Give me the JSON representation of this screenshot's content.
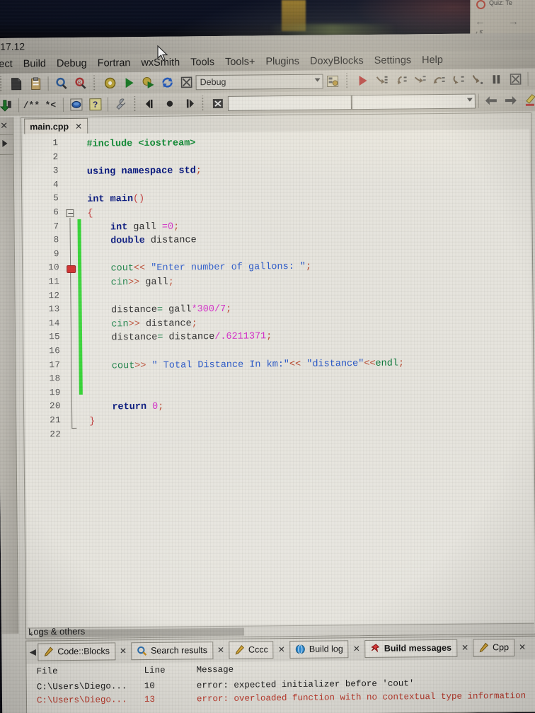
{
  "window": {
    "title": "17.12",
    "corner_window_title": "Quiz: Te"
  },
  "menubar": {
    "items": [
      "ect",
      "Build",
      "Debug",
      "Fortran",
      "wxSmith",
      "Tools",
      "Tools+",
      "Plugins",
      "DoxyBlocks",
      "Settings",
      "Help"
    ]
  },
  "toolbar_main": {
    "icons": [
      "new-file-icon",
      "paste-icon",
      "find-icon",
      "find-replace-icon",
      "build-icon",
      "run-icon",
      "build-and-run-icon",
      "rebuild-icon",
      "abort-icon"
    ],
    "target_combo_value": "Debug",
    "target_combo_placeholder": "Debug",
    "select_target_icon": "select-target-icon"
  },
  "toolbar_debug": {
    "icons": [
      "debug-continue-icon",
      "step-into-icon",
      "step-over-icon",
      "step-out-icon",
      "next-instruction-icon",
      "step-into-instruction-icon",
      "run-to-cursor-icon",
      "break-debugger-icon",
      "stop-debugger-icon",
      "debugging-windows-icon",
      "various-info-icon"
    ]
  },
  "toolbar_secondary": {
    "icons": [
      "jump-back-icon",
      "comment-icon",
      "uncomment-icon",
      "toggle-bookmark-icon",
      "help-icon",
      "settings-wrench-icon",
      "goto-prev-icon",
      "toggle-breakpoint-icon",
      "goto-next-icon",
      "clear-icon"
    ],
    "search_value": "",
    "search_placeholder": "",
    "nav_icons": [
      "search-prev-icon",
      "search-next-icon",
      "highlight-icon",
      "bookmark-icon",
      "match-case-icon",
      "regex-icon"
    ],
    "right_icons": [
      "select-mode-icon",
      "fullscreen-icon"
    ]
  },
  "left_panel": {
    "close_icon": "close-icon",
    "expand_icon": "expand-arrow-icon"
  },
  "editor": {
    "tab_label": "main.cpp",
    "tab_close": "✕",
    "line_numbers": [
      1,
      2,
      3,
      4,
      5,
      6,
      7,
      8,
      9,
      10,
      11,
      12,
      13,
      14,
      15,
      16,
      17,
      18,
      19,
      20,
      21,
      22
    ],
    "breakpoint_line": 10,
    "fold_line": 6,
    "change_bar_from_line": 7,
    "change_bar_to_line": 19,
    "lines": [
      {
        "n": 1,
        "tokens": [
          {
            "t": "#include ",
            "c": "pre"
          },
          {
            "t": "<iostream>",
            "c": "pre"
          }
        ]
      },
      {
        "n": 2,
        "tokens": []
      },
      {
        "n": 3,
        "tokens": [
          {
            "t": "using",
            "c": "kw"
          },
          {
            "t": " ",
            "c": "idf"
          },
          {
            "t": "namespace",
            "c": "kw"
          },
          {
            "t": " ",
            "c": "idf"
          },
          {
            "t": "std",
            "c": "kw"
          },
          {
            "t": ";",
            "c": "op"
          }
        ]
      },
      {
        "n": 4,
        "tokens": []
      },
      {
        "n": 5,
        "tokens": [
          {
            "t": "int",
            "c": "kw"
          },
          {
            "t": " ",
            "c": "idf"
          },
          {
            "t": "main",
            "c": "kw"
          },
          {
            "t": "()",
            "c": "brc"
          }
        ]
      },
      {
        "n": 6,
        "tokens": [
          {
            "t": "{",
            "c": "brc"
          }
        ]
      },
      {
        "n": 7,
        "tokens": [
          {
            "t": "    ",
            "c": "idf"
          },
          {
            "t": "int",
            "c": "kw"
          },
          {
            "t": " gall ",
            "c": "idf"
          },
          {
            "t": "=",
            "c": "num"
          },
          {
            "t": "0",
            "c": "num"
          },
          {
            "t": ";",
            "c": "op"
          }
        ]
      },
      {
        "n": 8,
        "tokens": [
          {
            "t": "    ",
            "c": "idf"
          },
          {
            "t": "double",
            "c": "kw"
          },
          {
            "t": " distance",
            "c": "idf"
          }
        ]
      },
      {
        "n": 9,
        "tokens": []
      },
      {
        "n": 10,
        "tokens": [
          {
            "t": "    ",
            "c": "idf"
          },
          {
            "t": "cout",
            "c": "opg"
          },
          {
            "t": "<<",
            "c": "op"
          },
          {
            "t": " ",
            "c": "idf"
          },
          {
            "t": "\"Enter number of gallons: \"",
            "c": "str"
          },
          {
            "t": ";",
            "c": "op"
          }
        ]
      },
      {
        "n": 11,
        "tokens": [
          {
            "t": "    ",
            "c": "idf"
          },
          {
            "t": "cin",
            "c": "opg"
          },
          {
            "t": ">>",
            "c": "op"
          },
          {
            "t": " gall",
            "c": "idf"
          },
          {
            "t": ";",
            "c": "op"
          }
        ]
      },
      {
        "n": 12,
        "tokens": []
      },
      {
        "n": 13,
        "tokens": [
          {
            "t": "    distance",
            "c": "idf"
          },
          {
            "t": "=",
            "c": "opg"
          },
          {
            "t": " gall",
            "c": "idf"
          },
          {
            "t": "*300",
            "c": "num"
          },
          {
            "t": "/7",
            "c": "num"
          },
          {
            "t": ";",
            "c": "op"
          }
        ]
      },
      {
        "n": 14,
        "tokens": [
          {
            "t": "    ",
            "c": "idf"
          },
          {
            "t": "cin",
            "c": "opg"
          },
          {
            "t": ">>",
            "c": "op"
          },
          {
            "t": " distance",
            "c": "idf"
          },
          {
            "t": ";",
            "c": "op"
          }
        ]
      },
      {
        "n": 15,
        "tokens": [
          {
            "t": "    distance",
            "c": "idf"
          },
          {
            "t": "=",
            "c": "opg"
          },
          {
            "t": " distance",
            "c": "idf"
          },
          {
            "t": "/",
            "c": "num"
          },
          {
            "t": ".6211371",
            "c": "num"
          },
          {
            "t": ";",
            "c": "op"
          }
        ]
      },
      {
        "n": 16,
        "tokens": []
      },
      {
        "n": 17,
        "tokens": [
          {
            "t": "    ",
            "c": "idf"
          },
          {
            "t": "cout",
            "c": "opg"
          },
          {
            "t": ">>",
            "c": "op"
          },
          {
            "t": " ",
            "c": "idf"
          },
          {
            "t": "\" Total Distance In km:\"",
            "c": "str"
          },
          {
            "t": "<<",
            "c": "op"
          },
          {
            "t": " ",
            "c": "idf"
          },
          {
            "t": "\"distance\"",
            "c": "str"
          },
          {
            "t": "<<",
            "c": "op"
          },
          {
            "t": "endl",
            "c": "opg"
          },
          {
            "t": ";",
            "c": "op"
          }
        ]
      },
      {
        "n": 18,
        "tokens": []
      },
      {
        "n": 19,
        "tokens": []
      },
      {
        "n": 20,
        "tokens": [
          {
            "t": "    ",
            "c": "idf"
          },
          {
            "t": "return",
            "c": "kw"
          },
          {
            "t": " ",
            "c": "idf"
          },
          {
            "t": "0",
            "c": "num"
          },
          {
            "t": ";",
            "c": "op"
          }
        ]
      },
      {
        "n": 21,
        "tokens": [
          {
            "t": "}",
            "c": "brc"
          }
        ]
      },
      {
        "n": 22,
        "tokens": []
      }
    ],
    "scroll_left_arrow": "‹"
  },
  "logs": {
    "panel_title": "Logs & others",
    "nav_left_icon": "scroll-left-icon",
    "tabs": [
      {
        "label": "Code::Blocks",
        "icon": "pencil-icon",
        "active": false,
        "close": "✕"
      },
      {
        "label": "Search results",
        "icon": "magnifier-icon",
        "active": false,
        "close": "✕"
      },
      {
        "label": "Cccc",
        "icon": "pencil-icon",
        "active": false,
        "close": "✕"
      },
      {
        "label": "Build log",
        "icon": "globe-icon",
        "active": false,
        "close": "✕"
      },
      {
        "label": "Build messages",
        "icon": "pin-icon",
        "active": true,
        "close": "✕"
      },
      {
        "label": "Cpp",
        "icon": "pencil-icon",
        "active": false,
        "close": "✕"
      }
    ],
    "columns": [
      "File",
      "Line",
      "Message"
    ],
    "rows": [
      {
        "file": "C:\\Users\\Diego...",
        "line": "10",
        "message": "error: expected initializer before 'cout'",
        "error": false
      },
      {
        "file": "C:\\Users\\Diego...",
        "line": "13",
        "message": "error: overloaded function with no contextual type information",
        "error": true
      }
    ]
  },
  "colors": {
    "keyword": "#00117a",
    "string": "#2656c8",
    "number": "#d428c8",
    "preprocessor": "#118a35",
    "change_bar": "#2ad22a",
    "breakpoint": "#cf2020",
    "error_text": "#c0392b"
  }
}
